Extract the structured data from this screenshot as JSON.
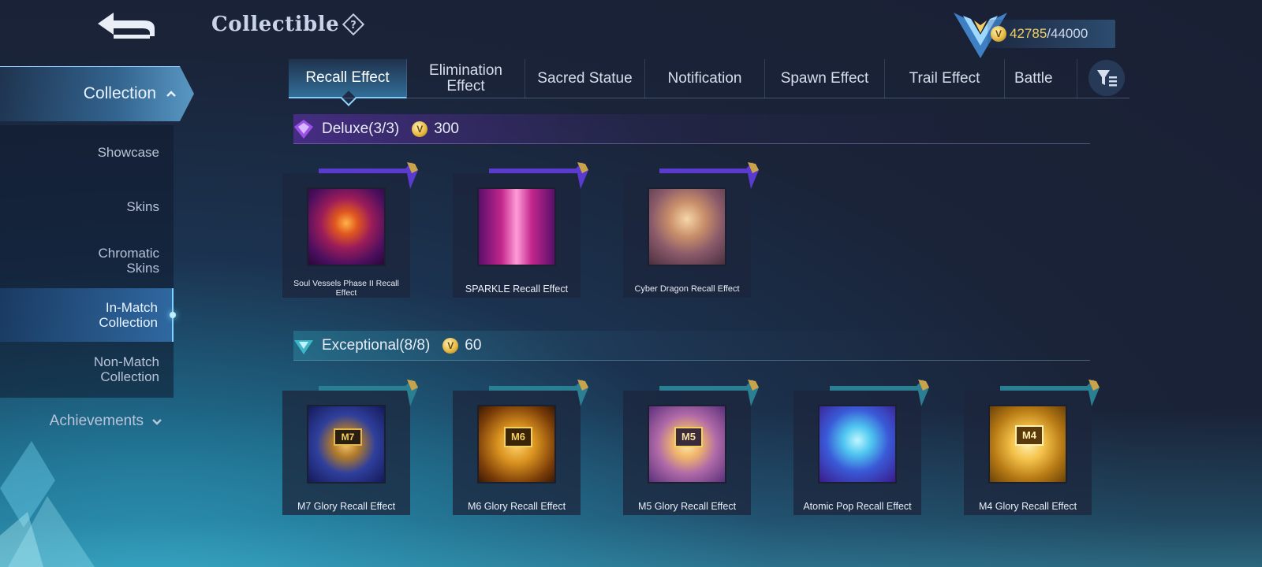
{
  "header": {
    "title": "Collectible",
    "currency_current": "42785",
    "currency_max": "/44000"
  },
  "sidebar": {
    "collection_label": "Collection",
    "items": [
      {
        "label": "Showcase"
      },
      {
        "label": "Skins"
      },
      {
        "label": "Chromatic Skins"
      },
      {
        "label": "In-Match Collection",
        "active": true
      },
      {
        "label": "Non-Match Collection"
      }
    ],
    "achievements_label": "Achievements"
  },
  "tabs": [
    {
      "label": "Recall Effect",
      "active": true
    },
    {
      "label": "Elimination Effect"
    },
    {
      "label": "Sacred Statue"
    },
    {
      "label": "Notification"
    },
    {
      "label": "Spawn Effect"
    },
    {
      "label": "Trail Effect"
    },
    {
      "label": "Battle"
    }
  ],
  "sections": {
    "deluxe": {
      "name": "Deluxe(3/3)",
      "price": "300",
      "items": [
        {
          "name": "Soul Vessels Phase II Recall Effect"
        },
        {
          "name": "SPARKLE Recall Effect"
        },
        {
          "name": "Cyber Dragon Recall Effect"
        }
      ]
    },
    "exceptional": {
      "name": "Exceptional(8/8)",
      "price": "60",
      "items": [
        {
          "name": "M7 Glory Recall Effect"
        },
        {
          "name": "M6 Glory Recall Effect"
        },
        {
          "name": "M5 Glory Recall Effect"
        },
        {
          "name": "Atomic Pop Recall Effect"
        },
        {
          "name": "M4 Glory Recall Effect"
        }
      ]
    }
  },
  "badges": {
    "m7": "M7",
    "m6": "M6",
    "m5": "M5",
    "m4": "M4"
  },
  "colors": {
    "accent": "#7fd0ff",
    "gold": "#f2cf62",
    "deluxe": "#8a3fd8",
    "exceptional": "#3fb6c8"
  }
}
